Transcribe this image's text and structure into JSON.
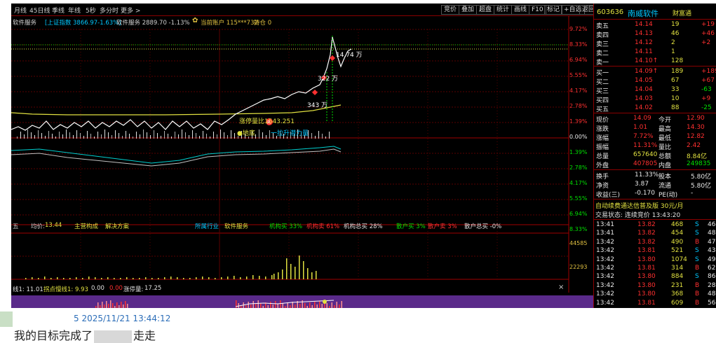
{
  "toolbar": {
    "left": [
      "月线",
      "45日线",
      "季线",
      "年线",
      "5秒",
      "多分时",
      "更多 >"
    ],
    "right": [
      "竞价",
      "叠加",
      "超盘",
      "统计",
      "画线",
      "F10",
      "标记",
      "+自选",
      "返回"
    ]
  },
  "chart_info": {
    "sector": "软件服务",
    "index_label": "[上证指数 3866.97-1.63%]",
    "sector_value": "软件服务 2889.70 -1.13%",
    "account_label": "当前账户 115***732",
    "position_label": "持仓 0"
  },
  "price_axis": [
    "9.72%",
    "8.33%",
    "6.94%",
    "5.55%",
    "4.17%",
    "2.78%",
    "1.39%",
    "0.00%",
    "1.39%",
    "2.78%",
    "4.17%",
    "5.55%",
    "6.94%",
    "8.33%"
  ],
  "volume_axis": [
    "44585",
    "22293"
  ],
  "annotations": {
    "a1": "14.74 万",
    "a2": "322 万",
    "a3": "343 万",
    "limit_up": "涨停量比1543.251",
    "low_point": "●地底",
    "rise_force": "一拉升潜力量",
    "mark": "R"
  },
  "info_strip": {
    "left_char": "五",
    "avg_label": "均价:",
    "avg_value": "13.44",
    "main_comp": "主营构成",
    "solution": "解决方案",
    "industry_label": "所属行业",
    "industry": "软件服务",
    "inst_buy": "机构买 33%",
    "inst_sell": "机构卖 61%",
    "inst_total": "机构总买 28%",
    "retail_buy": "散户买 3%",
    "retail_sell": "散户卖 3%",
    "retail_total": "散户总买 -0%"
  },
  "indicator_bar": {
    "line1": "线1: 11.01",
    "inflect": "拐点慢线1: 9.93",
    "zero": "0.00",
    "small_zero": "0.00",
    "limit_label": "涨停量:",
    "limit_value": "17.25"
  },
  "stock": {
    "code": "603636",
    "name": "南威软件",
    "tag": "财富通"
  },
  "order_book": {
    "asks": [
      {
        "label": "卖五",
        "price": "14.14",
        "vol": "19",
        "chg": "+19"
      },
      {
        "label": "卖四",
        "price": "14.13",
        "vol": "46",
        "chg": "+46"
      },
      {
        "label": "卖三",
        "price": "14.12",
        "vol": "2",
        "chg": "+2"
      },
      {
        "label": "卖二",
        "price": "14.11",
        "vol": "1",
        "chg": ""
      },
      {
        "label": "卖一",
        "price": "14.10↑",
        "vol": "128",
        "chg": ""
      }
    ],
    "bids": [
      {
        "label": "买一",
        "price": "14.09↑",
        "vol": "189",
        "chg": "+189"
      },
      {
        "label": "买二",
        "price": "14.05",
        "vol": "67",
        "chg": "+67"
      },
      {
        "label": "买三",
        "price": "14.04",
        "vol": "33",
        "chg": "-63"
      },
      {
        "label": "买四",
        "price": "14.03",
        "vol": "10",
        "chg": "+9"
      },
      {
        "label": "买五",
        "price": "14.02",
        "vol": "88",
        "chg": "-25"
      }
    ]
  },
  "quote": [
    {
      "l1": "现价",
      "v1": "14.09",
      "l2": "今开",
      "v2": "12.90"
    },
    {
      "l1": "涨跌",
      "v1": "1.01",
      "l2": "最高",
      "v2": "14.30"
    },
    {
      "l1": "涨幅",
      "v1": "7.72%",
      "l2": "最低",
      "v2": "12.82"
    },
    {
      "l1": "振幅",
      "v1": "11.31%",
      "l2": "量比",
      "v2": "2.42"
    },
    {
      "l1": "总量",
      "v1": "657640",
      "l2": "总额",
      "v2": "8.84亿"
    },
    {
      "l1": "外盘",
      "v1": "407805",
      "l2": "内盘",
      "v2": "249835"
    }
  ],
  "stats": [
    {
      "l1": "换手",
      "v1": "11.33%",
      "l2": "股本",
      "v2": "5.80亿"
    },
    {
      "l1": "净资",
      "v1": "3.87",
      "l2": "流通",
      "v2": "5.80亿"
    },
    {
      "l1": "收益(三)",
      "v1": "-0.170",
      "l2": "PE(动)",
      "v2": "-"
    }
  ],
  "ad_text": "自动续费通达信普及版 30元/月",
  "trade_status": "交易状态: 连续竞价 13:43:20",
  "ticks": [
    {
      "t": "13:41",
      "p": "13.82",
      "v": "468",
      "s": "S",
      "n": "46"
    },
    {
      "t": "13:41",
      "p": "13.82",
      "v": "454",
      "s": "S",
      "n": "48"
    },
    {
      "t": "13:42",
      "p": "13.82",
      "v": "490",
      "s": "B",
      "n": "47"
    },
    {
      "t": "13:42",
      "p": "13.81",
      "v": "521",
      "s": "S",
      "n": "43"
    },
    {
      "t": "13:42",
      "p": "13.80",
      "v": "1074",
      "s": "S",
      "n": "49"
    },
    {
      "t": "13:42",
      "p": "13.81",
      "v": "314",
      "s": "B",
      "n": "62"
    },
    {
      "t": "13:42",
      "p": "13.80",
      "v": "884",
      "s": "S",
      "n": "86"
    },
    {
      "t": "13:42",
      "p": "13.80",
      "v": "231",
      "s": "B",
      "n": "28"
    },
    {
      "t": "13:42",
      "p": "13.80",
      "v": "368",
      "s": "B",
      "n": "48"
    },
    {
      "t": "13:42",
      "p": "13.81",
      "v": "609",
      "s": "B",
      "n": "56"
    }
  ],
  "post": {
    "timestamp": "5 2025/11/21 13:44:12",
    "message_before": "我的目标完成了",
    "message_after": "走走"
  },
  "colors": {
    "up": "#ff3030",
    "down": "#00e000",
    "neutral": "#e8e8e8",
    "price_line": "#ffffff",
    "avg_line": "#e0e040",
    "bg": "#000000",
    "grid": "#8a0000",
    "accent": "#00c8ff"
  }
}
